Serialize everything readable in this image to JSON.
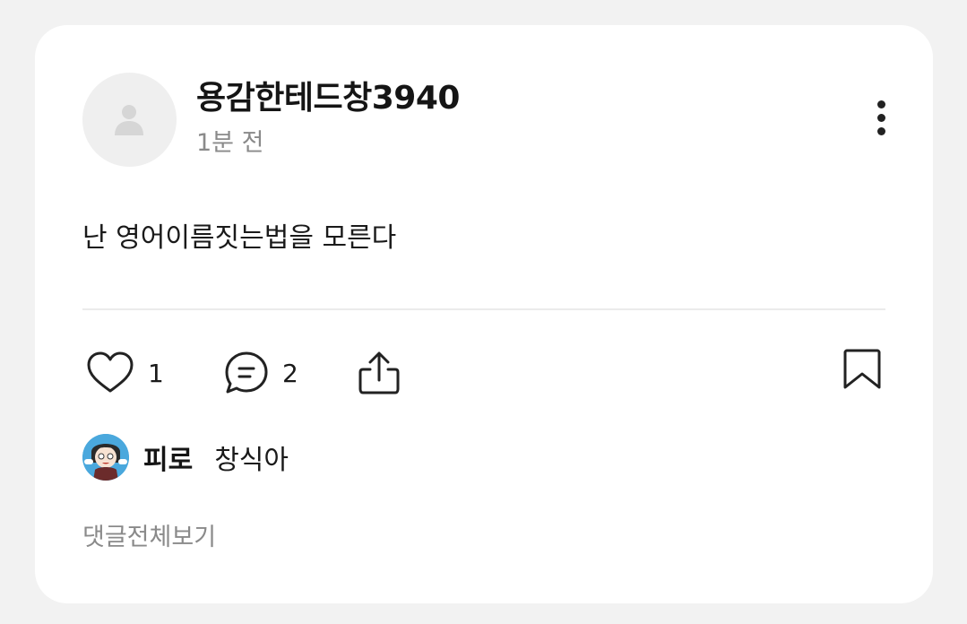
{
  "post": {
    "author": "용감한테드창3940",
    "time": "1분 전",
    "content": "난 영어이름짓는법을 모른다",
    "likes": "1",
    "comments": "2"
  },
  "icons": {
    "avatar": "person-placeholder-icon",
    "more": "more-vertical-icon",
    "like": "heart-icon",
    "comment": "speech-bubble-icon",
    "share": "share-icon",
    "bookmark": "bookmark-icon"
  },
  "comment_preview": {
    "name": "피로",
    "text": "창식아"
  },
  "view_all_comments": "댓글전체보기",
  "colors": {
    "background": "#f2f2f2",
    "card": "#ffffff",
    "muted_text": "#8a8a8a"
  }
}
